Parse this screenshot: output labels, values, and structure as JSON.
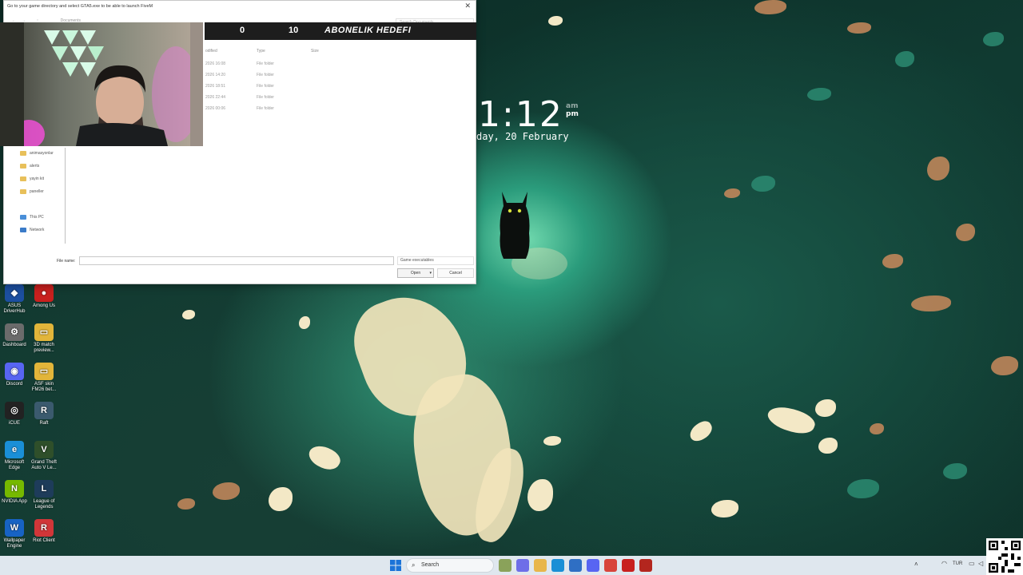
{
  "dialog": {
    "title": "Go to your game directory and select GTA5.exe to be able to launch FiveM",
    "address": "Documents",
    "search_placeholder": "Search Documents",
    "columns": {
      "modified": "odified",
      "type": "Type",
      "size": "Size"
    },
    "rows": [
      {
        "date": "2026 16:08",
        "type": "File folder"
      },
      {
        "date": "2026 14:20",
        "type": "File folder"
      },
      {
        "date": "2026 18:51",
        "type": "File folder"
      },
      {
        "date": "2026 22:44",
        "type": "File folder"
      },
      {
        "date": "2026 00:06",
        "type": "File folder"
      }
    ],
    "nav": [
      {
        "label": "animasyonlar",
        "icon": "folder-icon"
      },
      {
        "label": "alerts",
        "icon": "folder-icon"
      },
      {
        "label": "yayin kit",
        "icon": "folder-icon"
      },
      {
        "label": "paneller",
        "icon": "folder-icon"
      },
      {
        "label": "This PC",
        "icon": "pc-icon"
      },
      {
        "label": "Network",
        "icon": "network-icon"
      }
    ],
    "file_name_label": "File name:",
    "file_name_value": "",
    "file_type": "Game executables",
    "open_label": "Open",
    "cancel_label": "Cancel"
  },
  "goal": {
    "start": "0",
    "title": "ABONELIK HEDEFI",
    "end": "10"
  },
  "clock": {
    "time": "1:12",
    "am": "am",
    "pm": "pm",
    "date": "day, 20 February"
  },
  "desktop_icons": [
    {
      "label": "ASUS DriverHub",
      "color": "#1c4fa0",
      "glyph": "◆"
    },
    {
      "label": "Among Us",
      "color": "#c8201e",
      "glyph": "●"
    },
    {
      "label": "Dashboard",
      "color": "#6b6b6b",
      "glyph": "⚙"
    },
    {
      "label": "3D match preview...",
      "color": "#e2b53a",
      "glyph": "▭"
    },
    {
      "label": "Discord",
      "color": "#5865f2",
      "glyph": "◉"
    },
    {
      "label": "ASF skin FM26 bet...",
      "color": "#e2b53a",
      "glyph": "▭"
    },
    {
      "label": "iCUE",
      "color": "#222222",
      "glyph": "◎"
    },
    {
      "label": "Raft",
      "color": "#3b5a6e",
      "glyph": "R"
    },
    {
      "label": "Microsoft Edge",
      "color": "#1a8fd6",
      "glyph": "e"
    },
    {
      "label": "Grand Theft Auto V Le...",
      "color": "#2f4f2a",
      "glyph": "V"
    },
    {
      "label": "NVIDIA App",
      "color": "#76b900",
      "glyph": "N"
    },
    {
      "label": "League of Legends",
      "color": "#1e3c5a",
      "glyph": "L"
    },
    {
      "label": "Wallpaper Engine",
      "color": "#1763c4",
      "glyph": "W"
    },
    {
      "label": "Riot Client",
      "color": "#d13639",
      "glyph": "R"
    }
  ],
  "taskbar": {
    "search_label": "Search",
    "language": "TUR",
    "apps": [
      {
        "name": "widgets-icon",
        "color": "#8aa25a"
      },
      {
        "name": "copilot-icon",
        "color": "#6e6ee8"
      },
      {
        "name": "file-explorer-icon",
        "color": "#e8b64a"
      },
      {
        "name": "edge-icon",
        "color": "#1a8fd6"
      },
      {
        "name": "notepad-icon",
        "color": "#2f6fc4"
      },
      {
        "name": "discord-icon",
        "color": "#5865f2"
      },
      {
        "name": "chrome-icon",
        "color": "#d8443a"
      },
      {
        "name": "app-red-icon",
        "color": "#c8201e"
      },
      {
        "name": "acrobat-icon",
        "color": "#b3261e"
      }
    ]
  }
}
